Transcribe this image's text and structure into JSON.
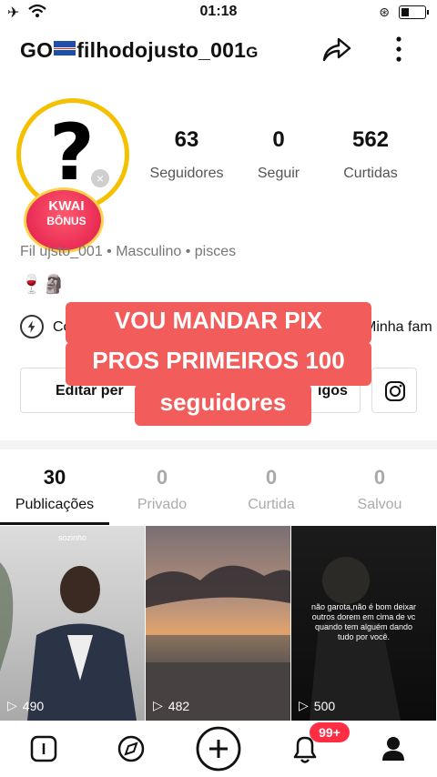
{
  "status_bar": {
    "time": "01:18"
  },
  "header": {
    "username_prefix": "GO",
    "username_main": "filhodojusto_001",
    "username_suffix": "G"
  },
  "avatar": {
    "badge_text_line1": "KWAI",
    "badge_text_line2": "BÔNUS"
  },
  "stats": [
    {
      "value": "63",
      "label": "Seguidores"
    },
    {
      "value": "0",
      "label": "Seguir"
    },
    {
      "value": "562",
      "label": "Curtidas"
    }
  ],
  "profile": {
    "meta": "Fil  ujsto_001  •  Masculino  •  pisces",
    "emojis": "🍷🗿",
    "bio_left": "Co",
    "bio_right": "Minha fam"
  },
  "actions": {
    "edit_left": "Editar per",
    "edit_right": "igos"
  },
  "overlay": {
    "line1": "VOU MANDAR PIX",
    "line2": "PROS PRIMEIROS 100",
    "line3": "seguidores"
  },
  "tabs": [
    {
      "count": "30",
      "label": "Publicações",
      "active": true
    },
    {
      "count": "0",
      "label": "Privado"
    },
    {
      "count": "0",
      "label": "Curtida"
    },
    {
      "count": "0",
      "label": "Salvou"
    }
  ],
  "videos": [
    {
      "views": "490",
      "caption": "sozinho"
    },
    {
      "views": "482",
      "caption": ""
    },
    {
      "views": "500",
      "caption": "não garota,não é bom deixar outros dorem em cima de vc quando tem alguém dando tudo por você."
    }
  ],
  "bottom_nav": {
    "notifications_badge": "99+"
  },
  "colors": {
    "accent": "#f25d5b",
    "badge": "#ff2e43",
    "ring": "#f4c000"
  }
}
